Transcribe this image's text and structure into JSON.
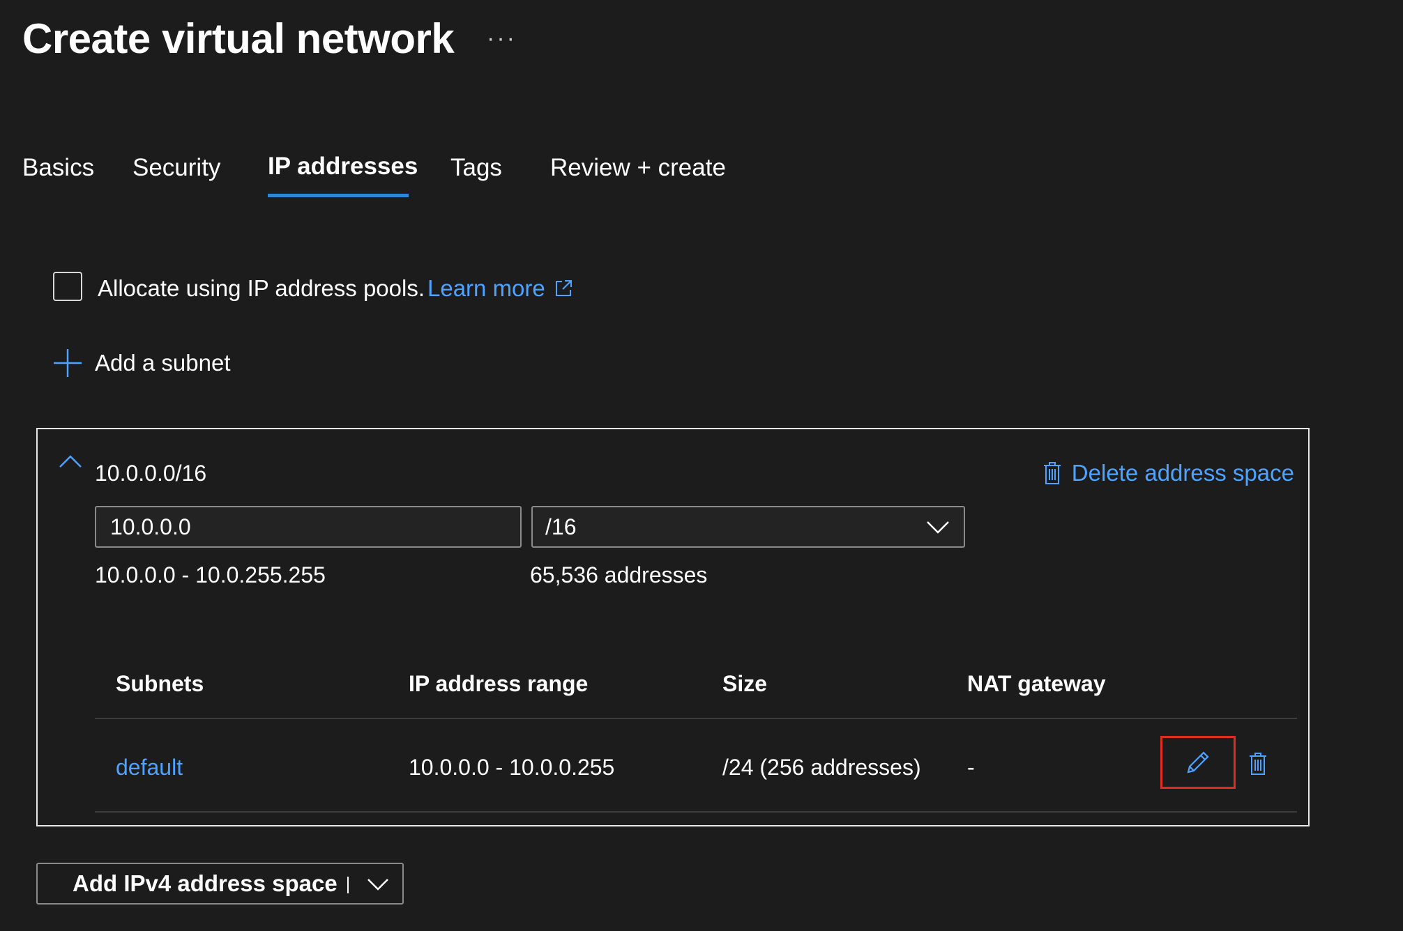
{
  "header": {
    "title": "Create virtual network",
    "more": "···"
  },
  "tabs": [
    {
      "label": "Basics"
    },
    {
      "label": "Security"
    },
    {
      "label": "IP addresses",
      "active": true
    },
    {
      "label": "Tags"
    },
    {
      "label": "Review + create"
    }
  ],
  "ip_pools": {
    "checked": false,
    "label": "Allocate using IP address pools.",
    "learn_more": "Learn more"
  },
  "add_subnet": {
    "label": "Add a subnet"
  },
  "address_space": {
    "cidr": "10.0.0.0/16",
    "delete_label": "Delete address space",
    "address_value": "10.0.0.0",
    "prefix_value": "/16",
    "range_text": "10.0.0.0 - 10.0.255.255",
    "count_text": "65,536 addresses"
  },
  "subnets_table": {
    "headers": [
      "Subnets",
      "IP address range",
      "Size",
      "NAT gateway"
    ],
    "rows": [
      {
        "name": "default",
        "range": "10.0.0.0 - 10.0.0.255",
        "size": "/24 (256 addresses)",
        "nat": "-"
      }
    ]
  },
  "add_ipv4": {
    "label": "Add IPv4 address space"
  },
  "colors": {
    "background": "#1c1c1c",
    "accent": "#4da3ff",
    "tab_underline": "#2b88d8",
    "highlight_border": "#e02c1e"
  },
  "icons": [
    "more-icon",
    "external-link-icon",
    "plus-icon",
    "chevron-up-icon",
    "trash-icon",
    "chevron-down-icon",
    "pencil-icon"
  ]
}
